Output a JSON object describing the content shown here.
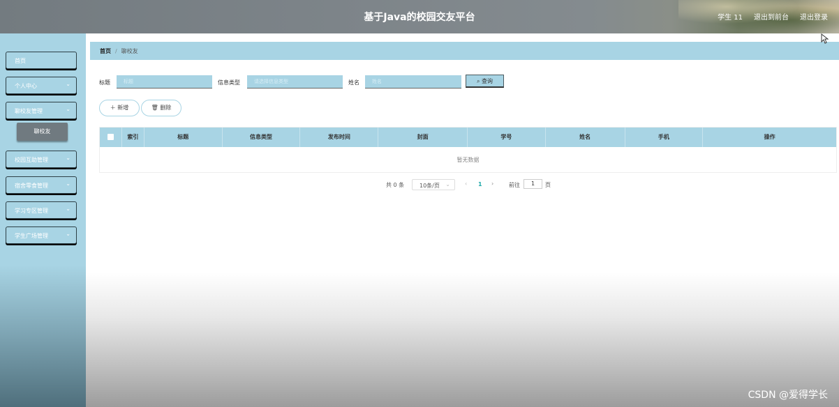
{
  "header": {
    "title": "基于Java的校园交友平台",
    "user": "学生 11",
    "exit_front": "退出到前台",
    "logout": "退出登录"
  },
  "sidebar": {
    "items": [
      {
        "label": "首页",
        "chevron": ""
      },
      {
        "label": "个人中心",
        "chevron": "⌄"
      },
      {
        "label": "聊校友管理",
        "chevron": "⌄"
      },
      {
        "label": "校园互助管理",
        "chevron": "⌄"
      },
      {
        "label": "宿舍零食管理",
        "chevron": "⌄"
      },
      {
        "label": "学习专区管理",
        "chevron": "⌄"
      },
      {
        "label": "学生广场管理",
        "chevron": "⌄"
      }
    ],
    "active_sub": "聊校友"
  },
  "breadcrumb": {
    "home": "首页",
    "separator": "/",
    "current": "聊校友"
  },
  "search": {
    "title_label": "标题",
    "title_placeholder": "标题",
    "type_label": "信息类型",
    "type_placeholder": "请选择信息类型",
    "name_label": "姓名",
    "name_placeholder": "姓名",
    "query_label": "查询"
  },
  "actions": {
    "add_label": "新增",
    "delete_label": "删除"
  },
  "table": {
    "columns": [
      "",
      "索引",
      "标题",
      "信息类型",
      "发布时间",
      "封面",
      "学号",
      "姓名",
      "手机",
      "操作"
    ],
    "empty_text": "暂无数据"
  },
  "pager": {
    "total": "共 0 条",
    "page_size": "10条/页",
    "current_page": "1",
    "goto_label": "前往",
    "goto_value": "1",
    "unit": "页"
  },
  "watermark": "CSDN @爱得学长",
  "colors": {
    "accent": "#a8d4e4",
    "header": "#7d8489"
  }
}
